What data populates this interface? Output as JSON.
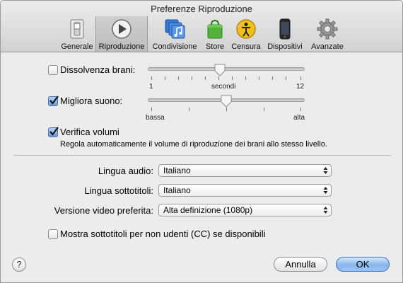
{
  "window": {
    "title": "Preferenze Riproduzione"
  },
  "tabs": [
    {
      "label": "Generale",
      "icon": "switch-icon"
    },
    {
      "label": "Riproduzione",
      "icon": "play-icon"
    },
    {
      "label": "Condivisione",
      "icon": "music-share-icon"
    },
    {
      "label": "Store",
      "icon": "shopping-bag-icon"
    },
    {
      "label": "Censura",
      "icon": "parental-icon"
    },
    {
      "label": "Dispositivi",
      "icon": "iphone-icon"
    },
    {
      "label": "Avanzate",
      "icon": "gear-icon"
    }
  ],
  "selected_tab": "Riproduzione",
  "crossfade": {
    "label": "Dissolvenza brani:",
    "checked": false,
    "min_label": "1",
    "mid_label": "secondi",
    "max_label": "12",
    "value": 6
  },
  "enhancer": {
    "label": "Migliora suono:",
    "checked": true,
    "min_label": "bassa",
    "max_label": "alta",
    "value": 0.5
  },
  "sound_check": {
    "label": "Verifica volumi",
    "checked": true,
    "description": "Regola automaticamente il volume di riproduzione dei brani allo stesso livello."
  },
  "audio_language": {
    "label": "Lingua audio:",
    "value": "Italiano"
  },
  "subtitle_language": {
    "label": "Lingua sottotitoli:",
    "value": "Italiano"
  },
  "video_version": {
    "label": "Versione video preferita:",
    "value": "Alta definizione (1080p)"
  },
  "closed_captions": {
    "label": "Mostra sottotitoli per non udenti (CC) se disponibili",
    "checked": false
  },
  "buttons": {
    "help": "?",
    "cancel": "Annulla",
    "ok": "OK"
  }
}
